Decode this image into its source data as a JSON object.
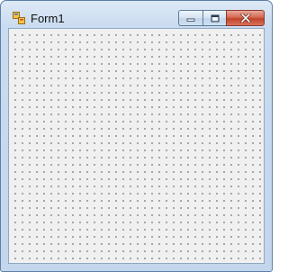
{
  "window": {
    "title": "Form1",
    "icons": {
      "app": "form-app-icon",
      "minimize": "minimize-icon",
      "maximize": "maximize-icon",
      "close": "close-icon"
    },
    "colors": {
      "frame": "#c3d6ec",
      "client_background": "#f0f0f0",
      "grid_dot": "#3a3a3a",
      "close_button": "#c0452b"
    }
  },
  "designer": {
    "grid": "dotted"
  }
}
